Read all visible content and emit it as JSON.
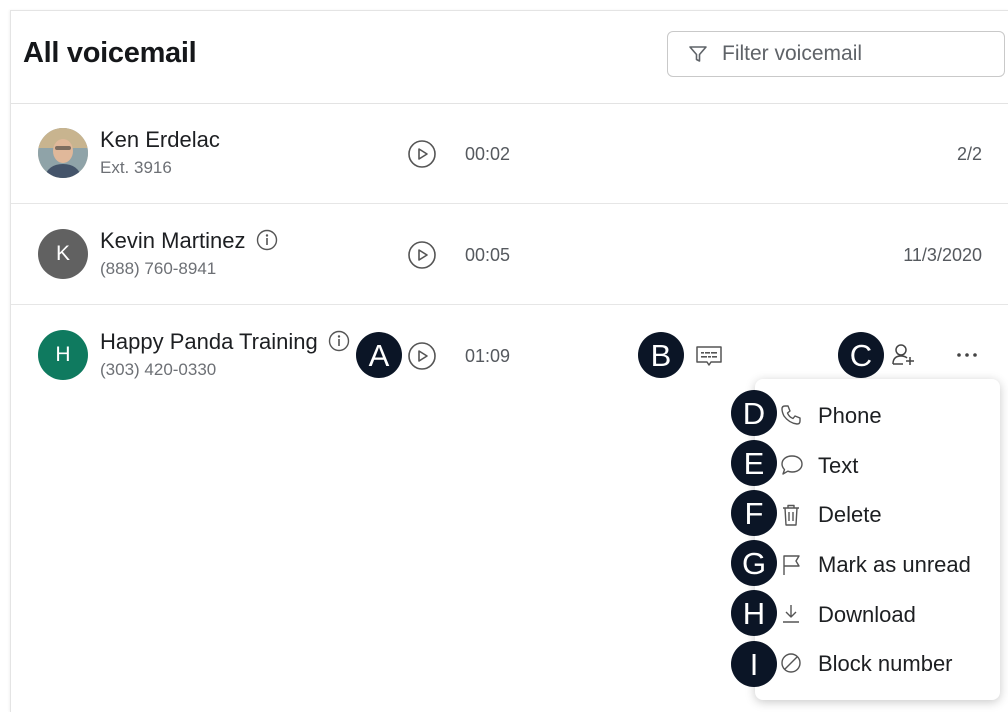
{
  "header": {
    "title": "All voicemail",
    "filter_placeholder": "Filter voicemail"
  },
  "voicemails": [
    {
      "name": "Ken Erdelac",
      "sub": "Ext. 3916",
      "duration": "00:02",
      "date": "2/2",
      "avatar": "photo"
    },
    {
      "name": "Kevin Martinez",
      "sub": "(888) 760-8941",
      "duration": "00:05",
      "date": "11/3/2020",
      "avatar_letter": "K",
      "avatar_color": "#616161"
    },
    {
      "name": "Happy Panda Training",
      "sub": "(303) 420-0330",
      "duration": "01:09",
      "date": "",
      "avatar_letter": "H",
      "avatar_color": "#0f7a5f"
    }
  ],
  "menu": {
    "items": [
      {
        "label": "Phone",
        "icon": "phone-icon"
      },
      {
        "label": "Text",
        "icon": "chat-bubble-icon"
      },
      {
        "label": "Delete",
        "icon": "trash-icon"
      },
      {
        "label": "Mark as unread",
        "icon": "flag-icon"
      },
      {
        "label": "Download",
        "icon": "download-icon"
      },
      {
        "label": "Block number",
        "icon": "block-icon"
      }
    ]
  },
  "callouts": [
    "A",
    "B",
    "C",
    "D",
    "E",
    "F",
    "G",
    "H",
    "I"
  ],
  "colors": {
    "badge": "#0b1526",
    "avatar_k": "#616161",
    "avatar_h": "#0f7a5f"
  }
}
